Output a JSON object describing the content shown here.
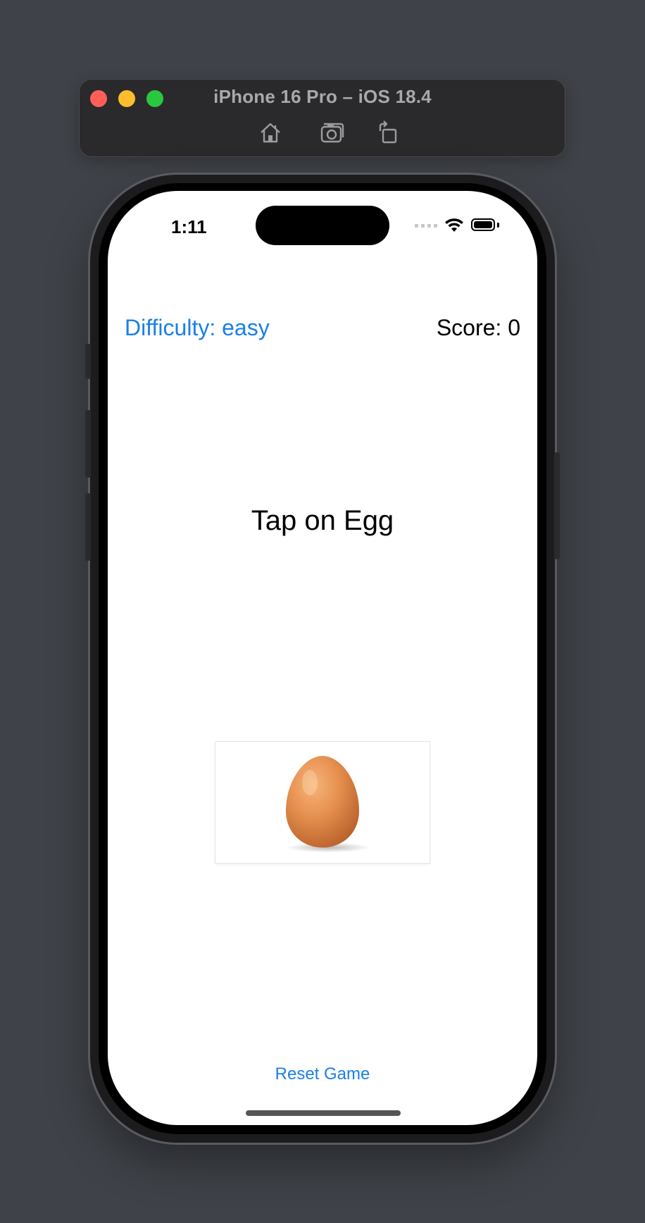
{
  "simulator": {
    "title": "iPhone 16 Pro – iOS 18.4",
    "toolbar_icons": [
      "home-icon",
      "screenshot-icon",
      "rotate-icon"
    ]
  },
  "status_bar": {
    "time": "1:11",
    "icons": [
      "cellular-signal-icon",
      "wifi-icon",
      "battery-icon"
    ]
  },
  "game": {
    "difficulty_label": "Difficulty: easy",
    "score_label": "Score: 0",
    "instruction": "Tap on Egg",
    "target_image": "egg-image",
    "reset_label": "Reset Game"
  },
  "colors": {
    "accent": "#1b7fe6",
    "background": "#3f4248",
    "screen": "#ffffff"
  }
}
